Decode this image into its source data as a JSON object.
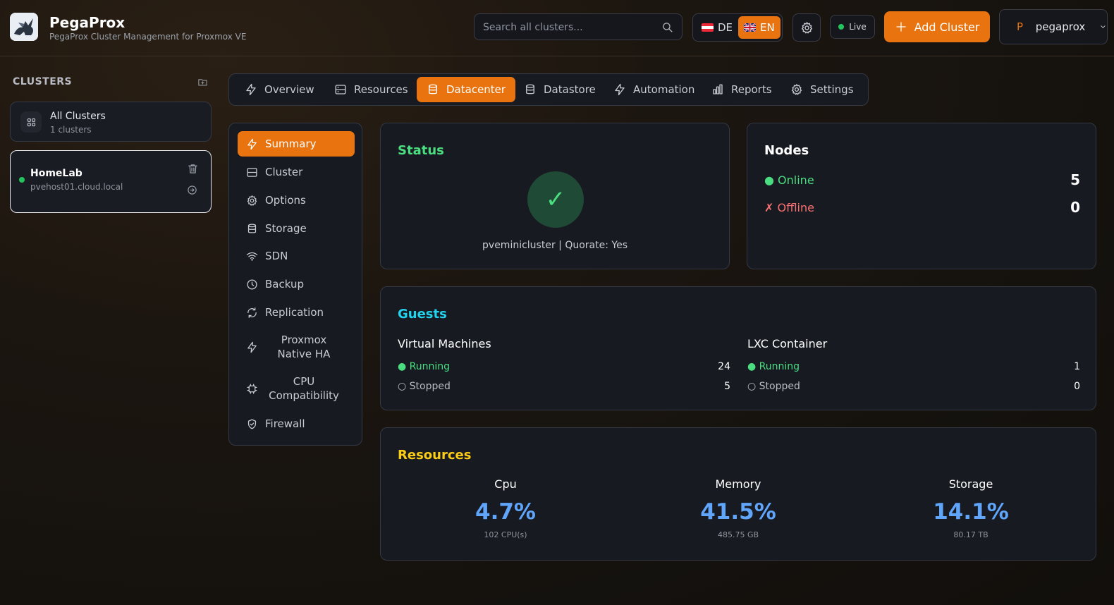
{
  "header": {
    "brand_title": "PegaProx",
    "brand_subtitle": "PegaProx Cluster Management for Proxmox VE",
    "search_placeholder": "Search all clusters...",
    "lang_de": "DE",
    "lang_en": "EN",
    "live_label": "Live",
    "add_cluster_label": "Add Cluster",
    "user_initial": "P",
    "user_name": "pegaprox"
  },
  "sidebar": {
    "heading": "CLUSTERS",
    "all_clusters": {
      "title": "All Clusters",
      "subtitle": "1 clusters"
    },
    "clusters": [
      {
        "name": "HomeLab",
        "host": "pvehost01.cloud.local",
        "status": "online"
      }
    ]
  },
  "tabs": [
    {
      "label": "Overview",
      "icon": "bolt-icon"
    },
    {
      "label": "Resources",
      "icon": "server-icon"
    },
    {
      "label": "Datacenter",
      "icon": "database-icon",
      "active": true
    },
    {
      "label": "Datastore",
      "icon": "database-icon"
    },
    {
      "label": "Automation",
      "icon": "bolt-icon"
    },
    {
      "label": "Reports",
      "icon": "chart-icon"
    },
    {
      "label": "Settings",
      "icon": "gear-icon"
    }
  ],
  "subnav": [
    {
      "label": "Summary",
      "icon": "bolt-icon",
      "active": true
    },
    {
      "label": "Cluster",
      "icon": "server-icon"
    },
    {
      "label": "Options",
      "icon": "gear-icon"
    },
    {
      "label": "Storage",
      "icon": "database-icon"
    },
    {
      "label": "SDN",
      "icon": "wifi-icon"
    },
    {
      "label": "Backup",
      "icon": "clock-icon"
    },
    {
      "label": "Replication",
      "icon": "refresh-icon"
    },
    {
      "label": "Proxmox Native HA",
      "icon": "bolt-icon"
    },
    {
      "label": "CPU Compatibility",
      "icon": "chip-icon"
    },
    {
      "label": "Firewall",
      "icon": "shield-icon"
    }
  ],
  "status": {
    "title": "Status",
    "check_glyph": "✓",
    "text": "pveminicluster | Quorate: Yes"
  },
  "nodes": {
    "title": "Nodes",
    "online_label": "● Online",
    "online_count": "5",
    "offline_label": "✗ Offline",
    "offline_count": "0"
  },
  "guests": {
    "title": "Guests",
    "vm": {
      "title": "Virtual Machines",
      "running_label": "● Running",
      "running": "24",
      "stopped_label": "○ Stopped",
      "stopped": "5"
    },
    "lxc": {
      "title": "LXC Container",
      "running_label": "● Running",
      "running": "1",
      "stopped_label": "○ Stopped",
      "stopped": "0"
    }
  },
  "resources": {
    "title": "Resources",
    "cpu": {
      "label": "Cpu",
      "percent": "4.7%",
      "detail": "102 CPU(s)"
    },
    "memory": {
      "label": "Memory",
      "percent": "41.5%",
      "detail": "485.75 GB"
    },
    "storage": {
      "label": "Storage",
      "percent": "14.1%",
      "detail": "80.17 TB"
    }
  },
  "colors": {
    "accent": "#e8730f",
    "status_green": "#4ade80",
    "guests_cyan": "#22d3ee",
    "resources_yellow": "#facc15",
    "offline_red": "#f87171",
    "percent_blue": "#60a5fa"
  }
}
